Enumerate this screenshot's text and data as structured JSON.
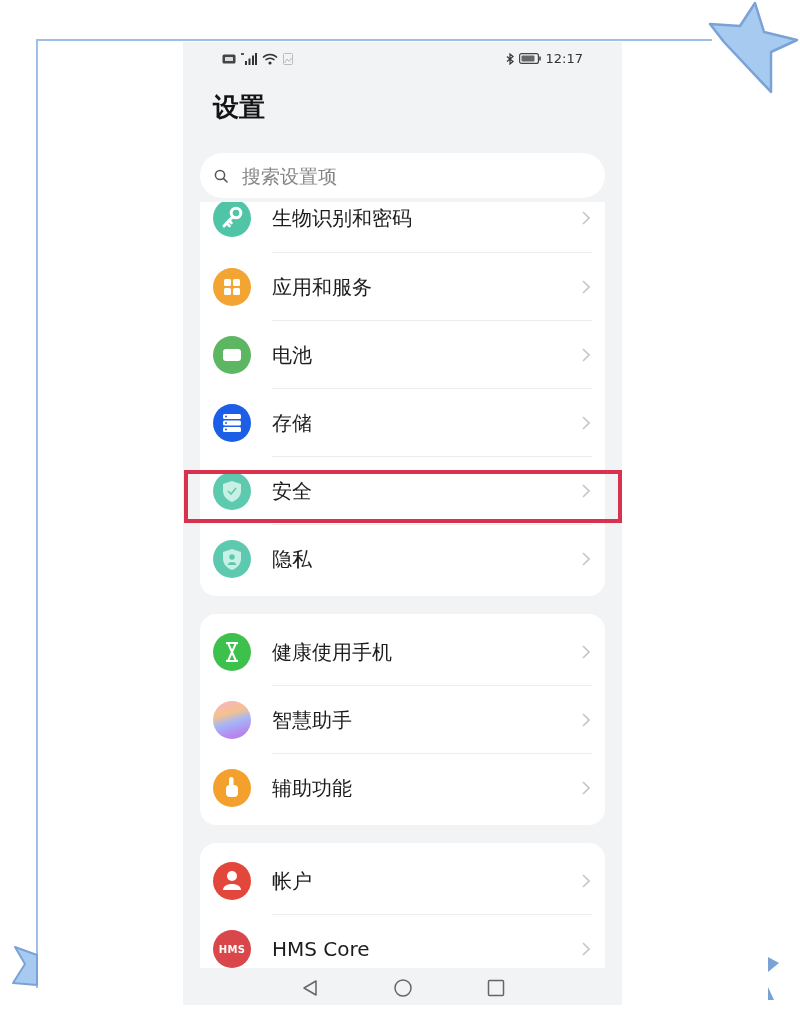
{
  "status_bar": {
    "time": "12:17"
  },
  "title": "设置",
  "search": {
    "placeholder": "搜索设置项"
  },
  "cards": [
    {
      "items": [
        {
          "label": "生物识别和密码",
          "highlighted": false
        },
        {
          "label": "应用和服务",
          "highlighted": false
        },
        {
          "label": "电池",
          "highlighted": false
        },
        {
          "label": "存储",
          "highlighted": false
        },
        {
          "label": "安全",
          "highlighted": true
        },
        {
          "label": "隐私",
          "highlighted": false
        }
      ]
    },
    {
      "items": [
        {
          "label": "健康使用手机",
          "highlighted": false
        },
        {
          "label": "智慧助手",
          "highlighted": false
        },
        {
          "label": "辅助功能",
          "highlighted": false
        }
      ]
    },
    {
      "items": [
        {
          "label": "帐户",
          "highlighted": false
        },
        {
          "label": "HMS Core",
          "badge": "HMS",
          "highlighted": false
        }
      ]
    }
  ]
}
